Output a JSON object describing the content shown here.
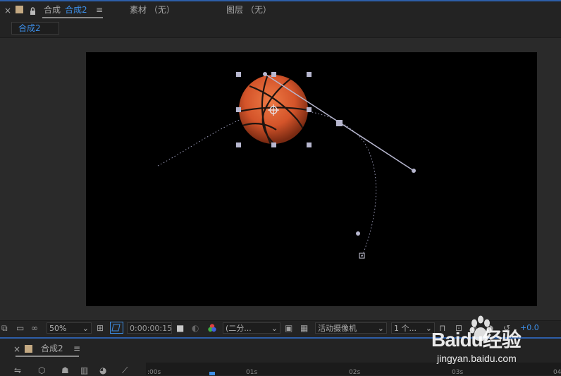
{
  "panel_tabs": {
    "close": "×",
    "comp_prefix": "合成",
    "comp_name": "合成2",
    "menu": "≡",
    "footage_tab": "素材 （无）",
    "layer_tab": "图层 （无）"
  },
  "breadcrumb": "合成2",
  "viewer_toolbar": {
    "zoom": "50%",
    "timecode": "0:00:00:15",
    "resolution": "(二分...",
    "camera": "活动摄像机",
    "views": "1 个...",
    "exposure": "+0.0"
  },
  "timeline": {
    "close": "×",
    "comp_name": "合成2",
    "menu": "≡",
    "ticks": [
      ":00s",
      "01s",
      "02s",
      "03s",
      "04"
    ]
  },
  "watermark": {
    "brand": "Baidu经验",
    "url": "jingyan.baidu.com"
  },
  "colors": {
    "accent": "#3d8ee6",
    "ball": "#d9562a",
    "handle": "#b7b7cf"
  }
}
